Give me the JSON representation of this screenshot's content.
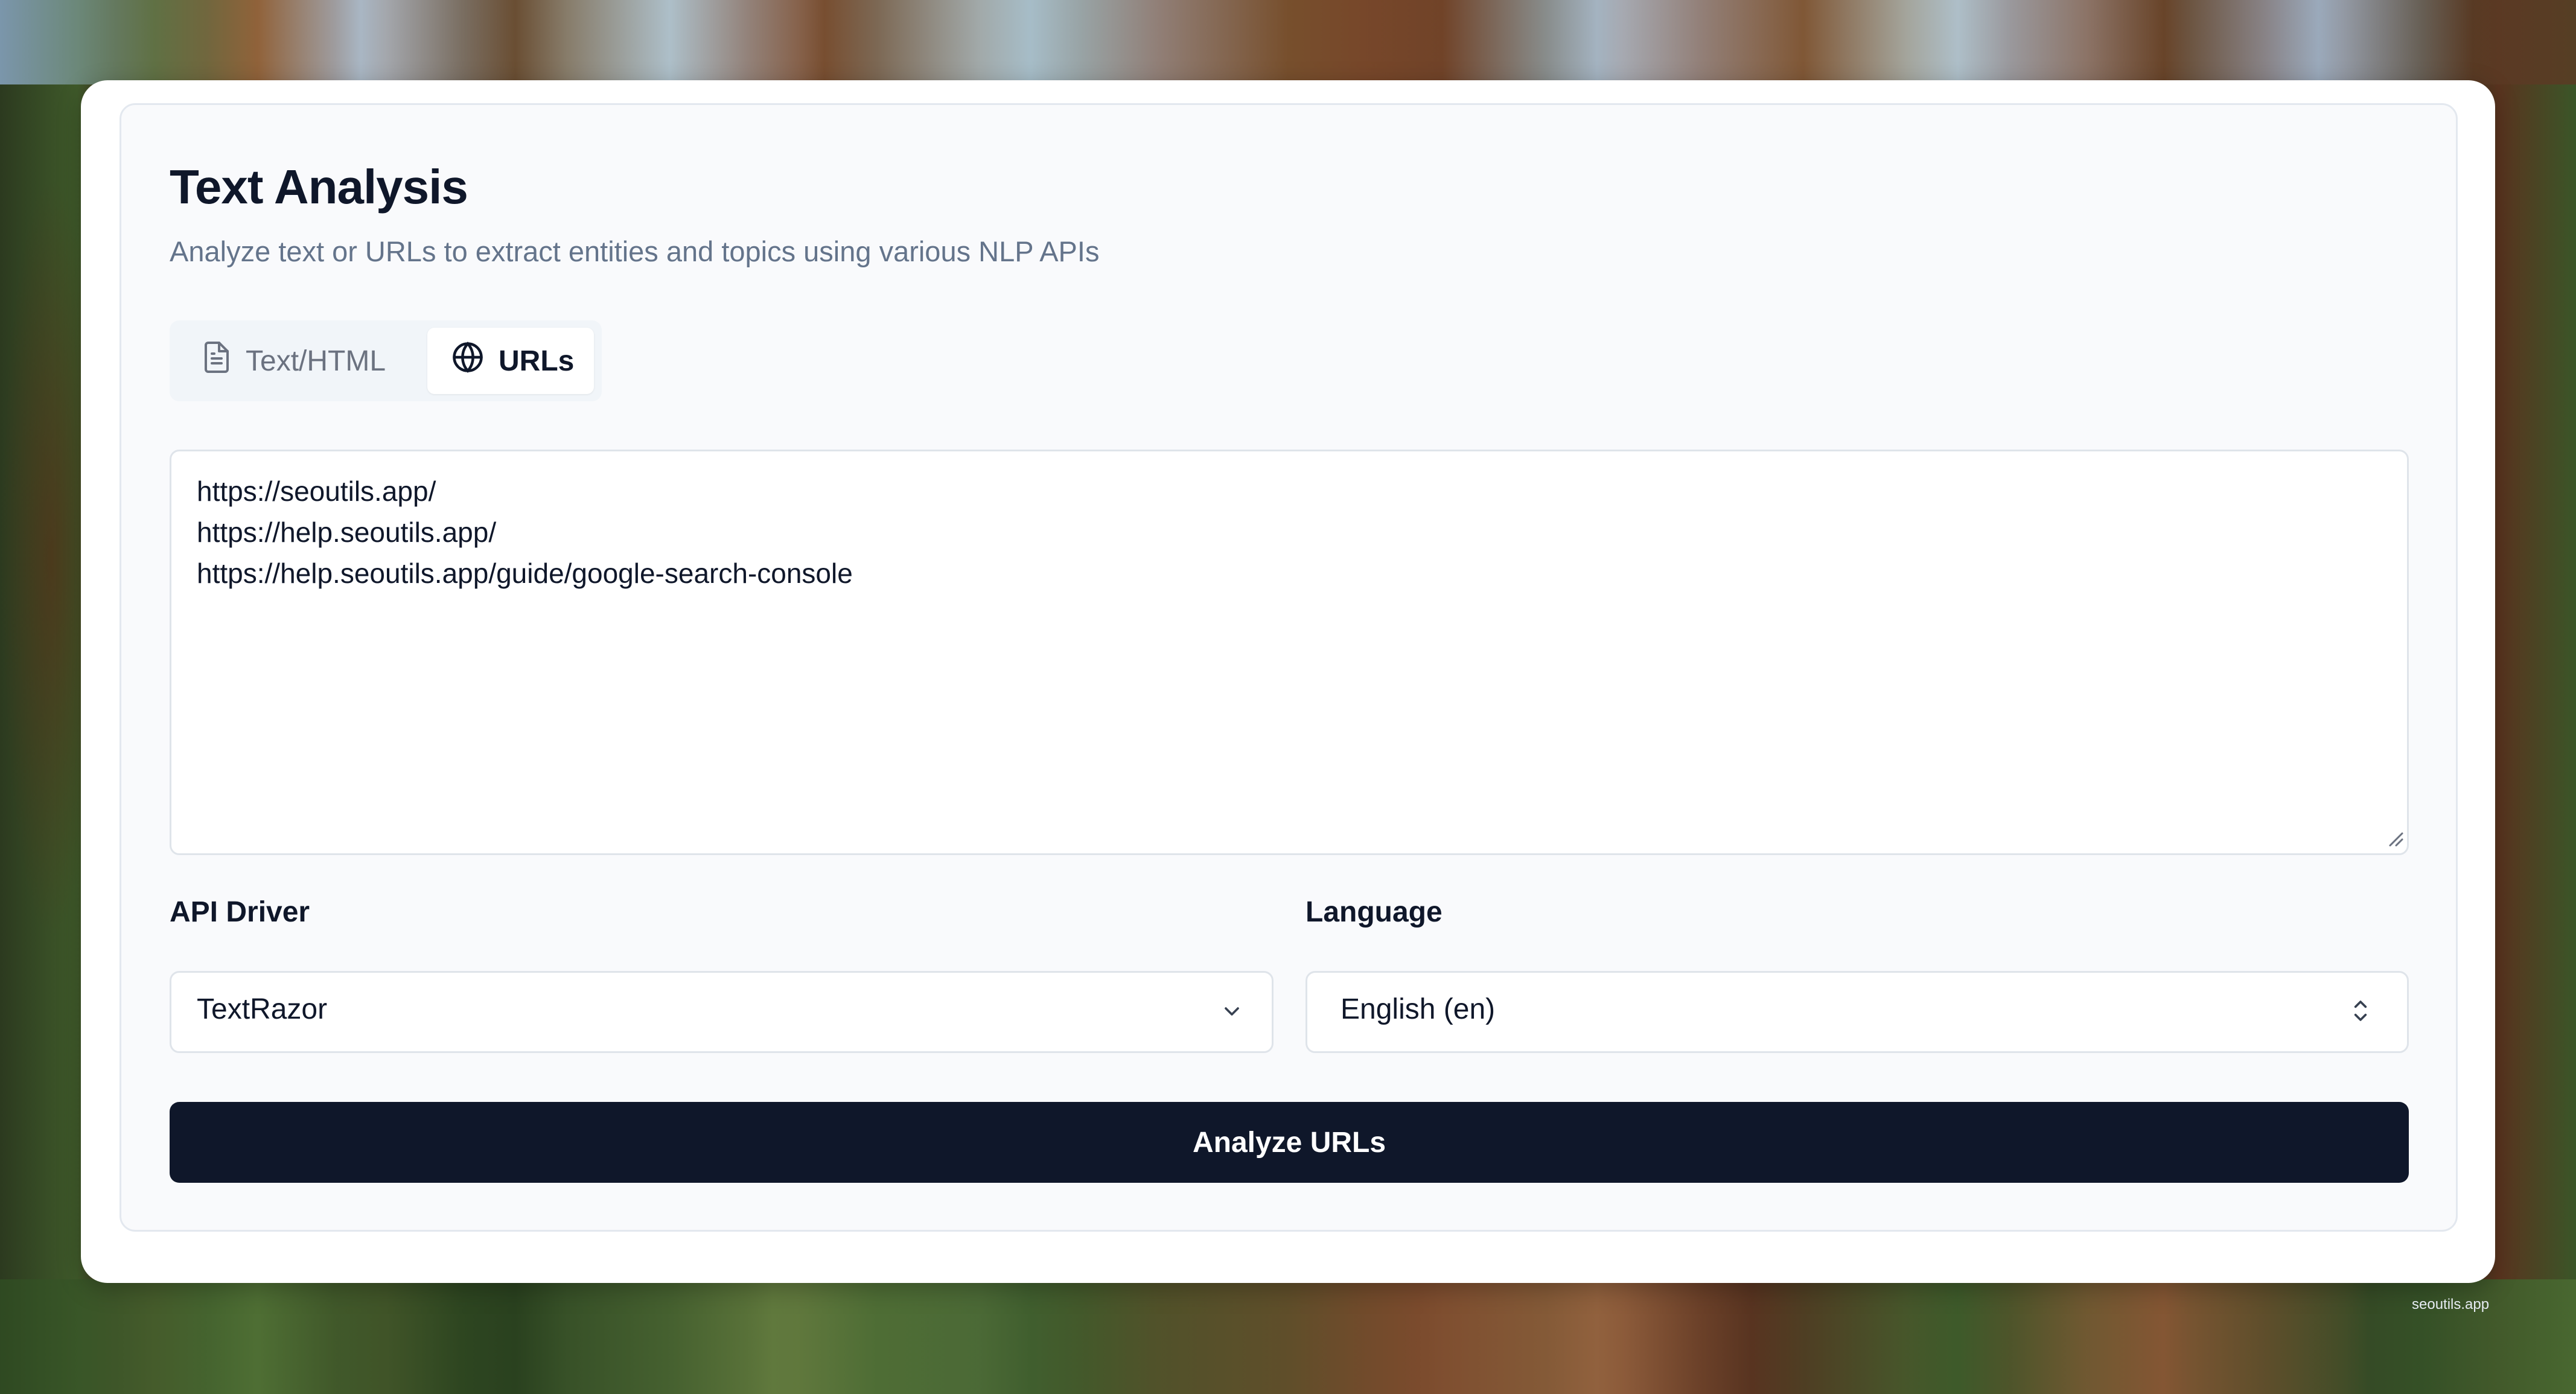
{
  "header": {
    "title": "Text Analysis",
    "subtitle": "Analyze text or URLs to extract entities and topics using various NLP APIs"
  },
  "tabs": [
    {
      "label": "Text/HTML",
      "icon": "document-icon",
      "selected": false
    },
    {
      "label": "URLs",
      "icon": "globe-icon",
      "selected": true
    }
  ],
  "url_input": {
    "lines": [
      "https://seoutils.app/",
      "https://help.seoutils.app/",
      "https://help.seoutils.app/guide/google-search-console"
    ]
  },
  "api_driver": {
    "label": "API Driver",
    "value": "TextRazor",
    "icon": "chevron-down-icon"
  },
  "language": {
    "label": "Language",
    "value": "English (en)",
    "icon": "chevrons-up-down-icon"
  },
  "actions": {
    "analyze_label": "Analyze URLs"
  },
  "footer": {
    "watermark": "seoutils.app"
  },
  "colors": {
    "primary": "#0f172a",
    "muted_text": "#64748b",
    "border": "#dfe4ea"
  }
}
